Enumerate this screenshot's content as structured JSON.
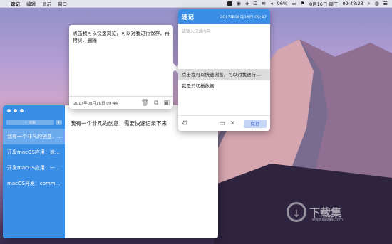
{
  "menubar": {
    "app": "速记",
    "items": [
      "编辑",
      "显示",
      "窗口"
    ],
    "battery": "96%",
    "datetime": "8月16日 周三",
    "time": "09:48:23"
  },
  "main": {
    "search_placeholder": "搜索",
    "add_label": "+",
    "notes": [
      "我有一个非凡的创意，需要...",
      "开发macOS应用：速记...",
      "开发macOS应用：一...",
      "macOS开发：comma..."
    ],
    "editor_text": "我有一个非凡的创意，需要快速记录下来"
  },
  "preview": {
    "body": "点击我可以快速浏览，可以对我进行保存、再拷贝、删除",
    "date": "2017年08月16日 09:44"
  },
  "popup": {
    "title": "速记",
    "date": "2017年08月16日 09:47",
    "placeholder": "请输入记录内容",
    "clips": [
      "点击我可以快速浏览，可以对我进行...",
      "我是剪切板数据"
    ],
    "save_label": "保存"
  },
  "watermark": {
    "text": "下载集",
    "url": "www.xiazaiji.com"
  },
  "colors": {
    "accent": "#3a8ee6",
    "save_bg": "#c5d5f5"
  }
}
